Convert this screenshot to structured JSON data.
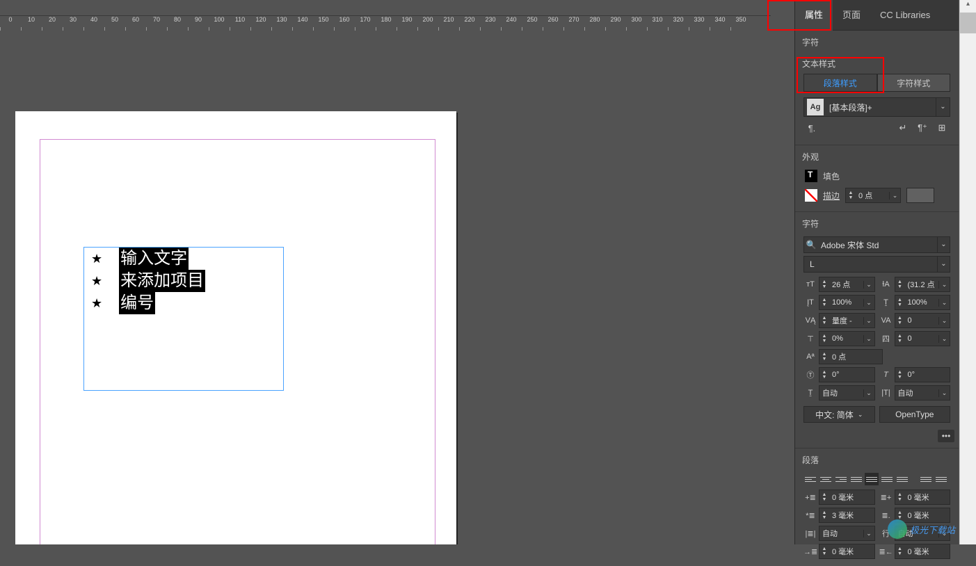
{
  "ruler": {
    "ticks": [
      0,
      10,
      20,
      30,
      40,
      50,
      60,
      70,
      80,
      90,
      100,
      110,
      120,
      130,
      140,
      150,
      160,
      170,
      180,
      190,
      200,
      210,
      220,
      230,
      240,
      250,
      260,
      270,
      280,
      290,
      300,
      310,
      320,
      330,
      340,
      350
    ]
  },
  "canvas": {
    "bullets": [
      {
        "star": "★",
        "text": "输入文字"
      },
      {
        "star": "★",
        "text": "来添加项目"
      },
      {
        "star": "★",
        "text": "编号"
      }
    ]
  },
  "panel": {
    "tabs": {
      "properties": "属性",
      "pages": "页面",
      "cc": "CC Libraries"
    },
    "char_header": "字符",
    "text_style": {
      "title": "文本样式",
      "paragraph_style": "段落样式",
      "character_style": "字符样式",
      "ag": "Ag",
      "current": "[基本段落]+",
      "pilcrow": "¶"
    },
    "appearance": {
      "title": "外观",
      "fill": "填色",
      "stroke": "描边",
      "stroke_weight": "0 点"
    },
    "character": {
      "title": "字符",
      "font": "Adobe 宋体 Std",
      "style": "L",
      "size": "26 点",
      "leading": "(31.2 点",
      "vscale": "100%",
      "hscale": "100%",
      "kerning": "量度 -",
      "tracking": "0",
      "tsume": "0%",
      "aki": "0",
      "baseline": "0 点",
      "rotation": "0°",
      "skew": "0°",
      "lang1": "自动",
      "lang2": "自动",
      "lang_btn": "中文: 简体",
      "opentype": "OpenType"
    },
    "paragraph": {
      "title": "段落",
      "left_indent": "0 毫米",
      "right_indent": "0 毫米",
      "first_indent": "3 毫米",
      "last_indent": "0 毫米",
      "auto1": "自动",
      "auto2": "自动",
      "sp1": "0 毫米",
      "sp2": "0 毫米"
    }
  },
  "watermark": "极光下载站"
}
